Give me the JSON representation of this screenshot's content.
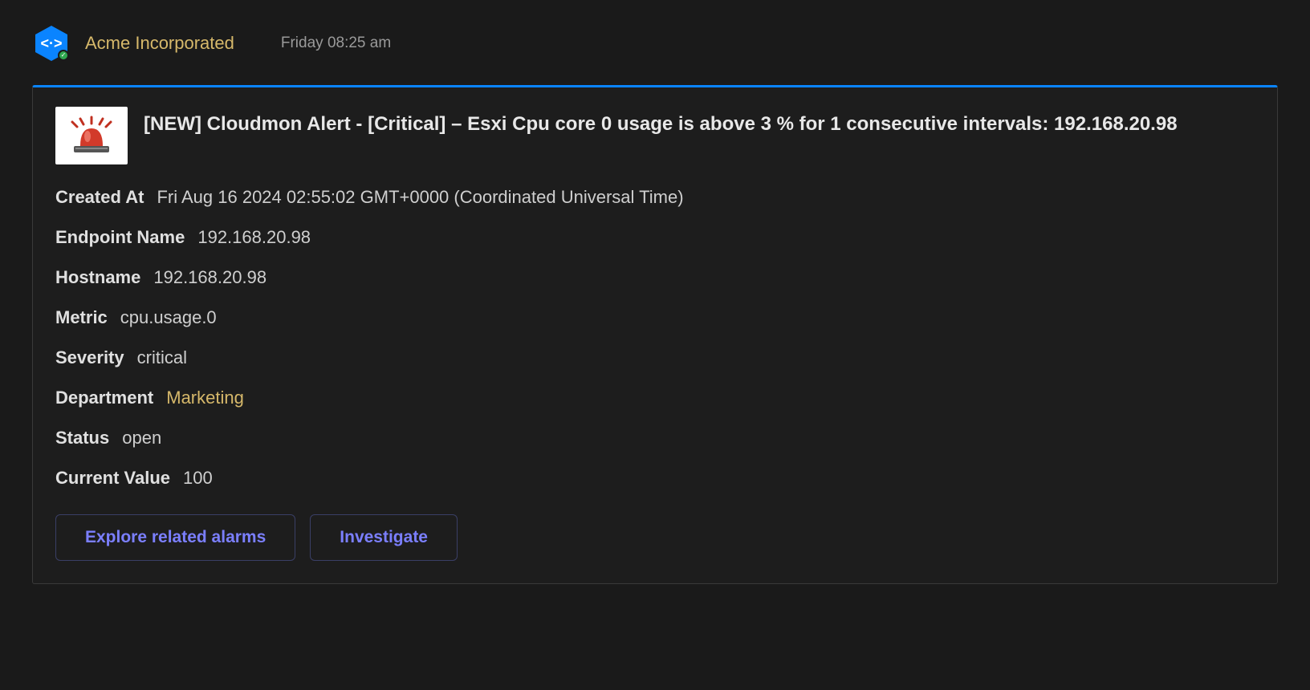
{
  "header": {
    "company": "Acme Incorporated",
    "time": "Friday 08:25 am"
  },
  "alert": {
    "title": "[NEW] Cloudmon Alert - [Critical] – Esxi Cpu core 0 usage is above 3 % for 1 consecutive intervals: 192.168.20.98",
    "fields": {
      "created_at": {
        "label": "Created At",
        "value": "Fri Aug 16 2024 02:55:02 GMT+0000 (Coordinated Universal Time)"
      },
      "endpoint_name": {
        "label": "Endpoint Name",
        "value": "192.168.20.98"
      },
      "hostname": {
        "label": "Hostname",
        "value": "192.168.20.98"
      },
      "metric": {
        "label": "Metric",
        "value": "cpu.usage.0"
      },
      "severity": {
        "label": "Severity",
        "value": "critical"
      },
      "department": {
        "label": "Department",
        "value": "Marketing"
      },
      "status": {
        "label": "Status",
        "value": "open"
      },
      "current_value": {
        "label": "Current Value",
        "value": "100"
      }
    }
  },
  "actions": {
    "explore": "Explore related alarms",
    "investigate": "Investigate"
  }
}
